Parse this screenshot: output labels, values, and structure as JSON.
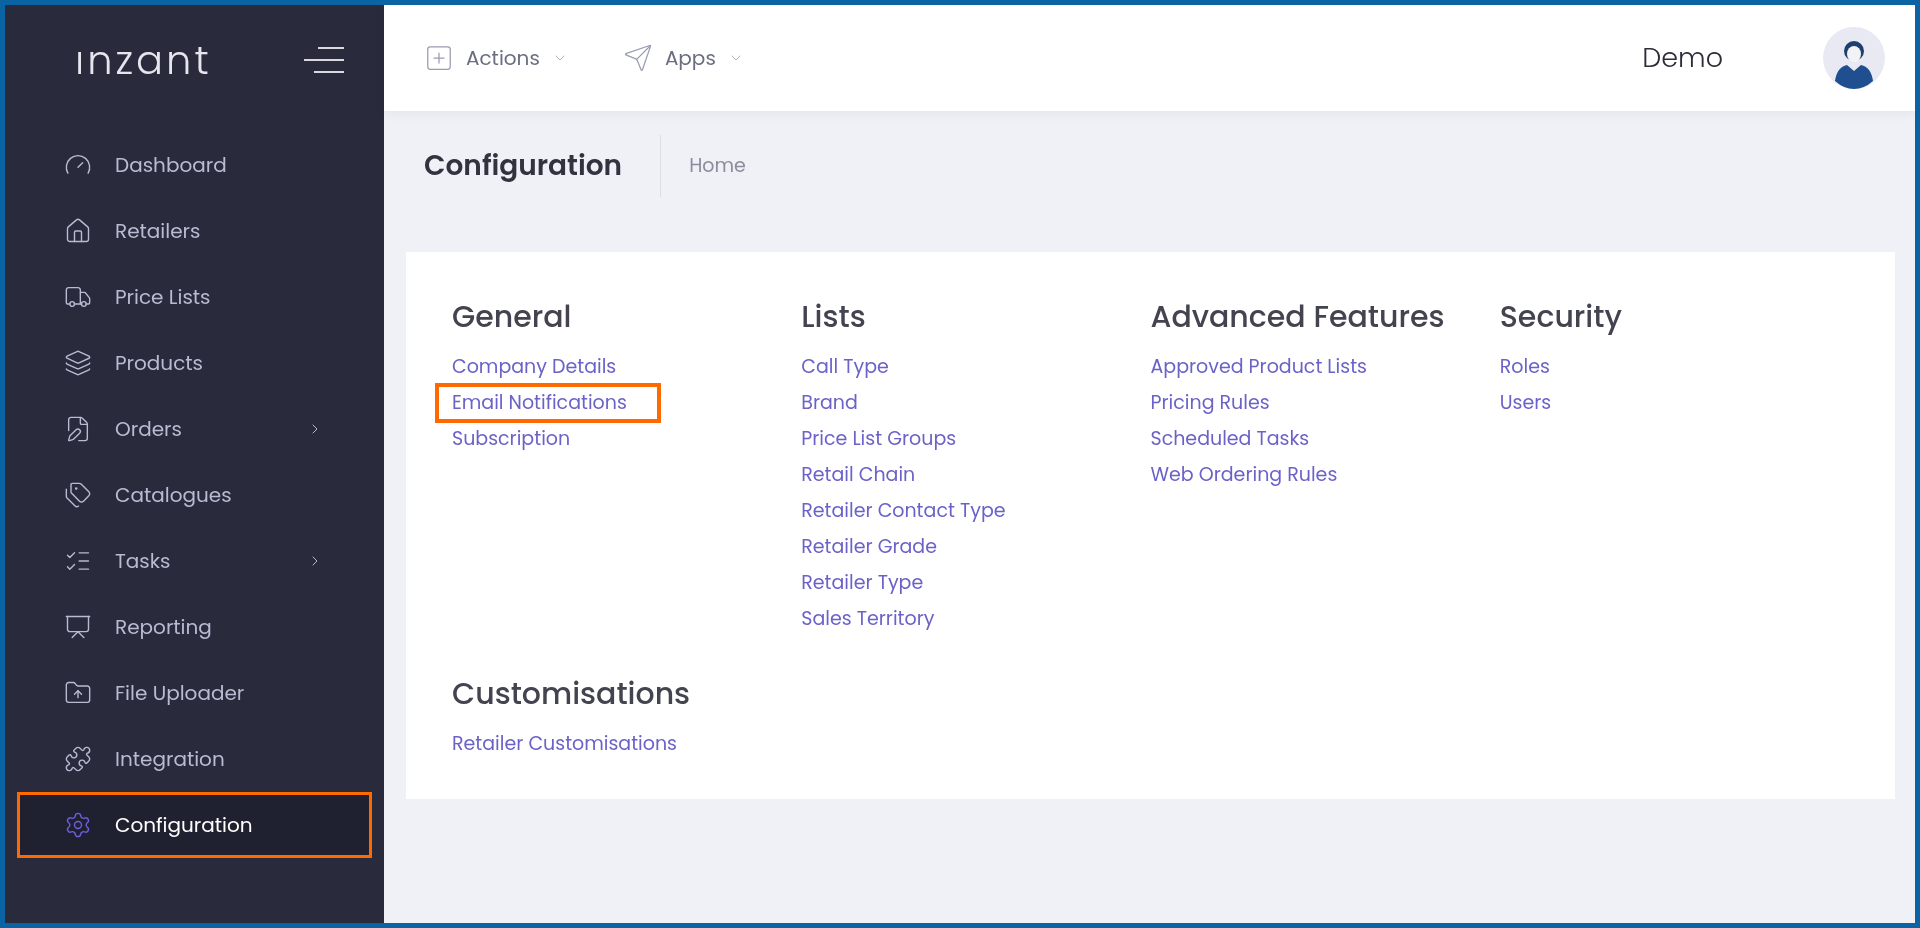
{
  "sidebar": {
    "logo": "ınzant",
    "items": [
      {
        "label": "Dashboard",
        "has_submenu": false,
        "selected": false,
        "highlighted": false
      },
      {
        "label": "Retailers",
        "has_submenu": false,
        "selected": false,
        "highlighted": false
      },
      {
        "label": "Price Lists",
        "has_submenu": false,
        "selected": false,
        "highlighted": false
      },
      {
        "label": "Products",
        "has_submenu": false,
        "selected": false,
        "highlighted": false
      },
      {
        "label": "Orders",
        "has_submenu": true,
        "selected": false,
        "highlighted": false
      },
      {
        "label": "Catalogues",
        "has_submenu": false,
        "selected": false,
        "highlighted": false
      },
      {
        "label": "Tasks",
        "has_submenu": true,
        "selected": false,
        "highlighted": false
      },
      {
        "label": "Reporting",
        "has_submenu": false,
        "selected": false,
        "highlighted": false
      },
      {
        "label": "File Uploader",
        "has_submenu": false,
        "selected": false,
        "highlighted": false
      },
      {
        "label": "Integration",
        "has_submenu": false,
        "selected": false,
        "highlighted": false
      },
      {
        "label": "Configuration",
        "has_submenu": false,
        "selected": true,
        "highlighted": true
      }
    ]
  },
  "header": {
    "menus": [
      "Actions",
      "Apps"
    ],
    "user": "Demo"
  },
  "page": {
    "title": "Configuration",
    "breadcrumb": "Home"
  },
  "sections": [
    {
      "title": "General",
      "links": [
        {
          "label": "Company Details",
          "highlighted": false
        },
        {
          "label": "Email Notifications",
          "highlighted": true
        },
        {
          "label": "Subscription",
          "highlighted": false
        }
      ]
    },
    {
      "title": "Lists",
      "links": [
        {
          "label": "Call Type",
          "highlighted": false
        },
        {
          "label": "Brand",
          "highlighted": false
        },
        {
          "label": "Price List Groups",
          "highlighted": false
        },
        {
          "label": "Retail Chain",
          "highlighted": false
        },
        {
          "label": "Retailer Contact Type",
          "highlighted": false
        },
        {
          "label": "Retailer Grade",
          "highlighted": false
        },
        {
          "label": "Retailer Type",
          "highlighted": false
        },
        {
          "label": "Sales Territory",
          "highlighted": false
        }
      ]
    },
    {
      "title": "Advanced Features",
      "links": [
        {
          "label": "Approved Product Lists",
          "highlighted": false
        },
        {
          "label": "Pricing Rules",
          "highlighted": false
        },
        {
          "label": "Scheduled Tasks",
          "highlighted": false
        },
        {
          "label": "Web Ordering Rules",
          "highlighted": false
        }
      ]
    },
    {
      "title": "Security",
      "links": [
        {
          "label": "Roles",
          "highlighted": false
        },
        {
          "label": "Users",
          "highlighted": false
        }
      ]
    },
    {
      "title": "Customisations",
      "links": [
        {
          "label": "Retailer Customisations",
          "highlighted": false
        }
      ]
    }
  ]
}
